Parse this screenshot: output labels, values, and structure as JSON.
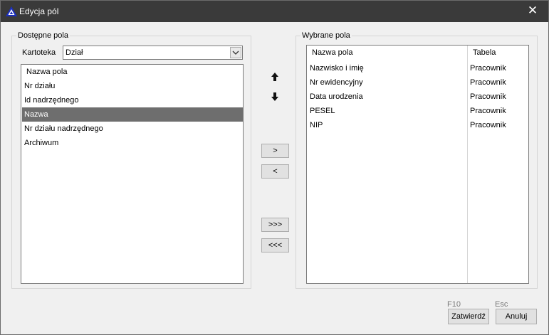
{
  "window": {
    "title": "Edycja pól",
    "close_glyph": "✕"
  },
  "left": {
    "group_label": "Dostępne pola",
    "kartoteka_label": "Kartoteka",
    "kartoteka_value": "Dział",
    "list_header": "Nazwa pola",
    "items": [
      "Nr działu",
      "Id nadrzędnego",
      "Nazwa",
      "Nr działu nadrzędnego",
      "Archiwum"
    ],
    "selected_index": 2
  },
  "controls": {
    "up_icon": "arrow-up-icon",
    "down_icon": "arrow-down-icon",
    "add": ">",
    "remove": "<",
    "add_all": ">>>",
    "remove_all": "<<<"
  },
  "right": {
    "group_label": "Wybrane pola",
    "col_name": "Nazwa pola",
    "col_table": "Tabela",
    "rows": [
      {
        "name": "Nazwisko i imię",
        "table": "Pracownik"
      },
      {
        "name": "Nr ewidencyjny",
        "table": "Pracownik"
      },
      {
        "name": "Data urodzenia",
        "table": "Pracownik"
      },
      {
        "name": "PESEL",
        "table": "Pracownik"
      },
      {
        "name": "NIP",
        "table": "Pracownik"
      }
    ]
  },
  "footer": {
    "confirm_shortcut": "F10",
    "confirm": "Zatwierdź",
    "cancel_shortcut": "Esc",
    "cancel": "Anuluj"
  },
  "colors": {
    "titlebar": "#3a3a3a",
    "selection": "#6e6e6e",
    "app_icon": "#1b2fbf"
  }
}
